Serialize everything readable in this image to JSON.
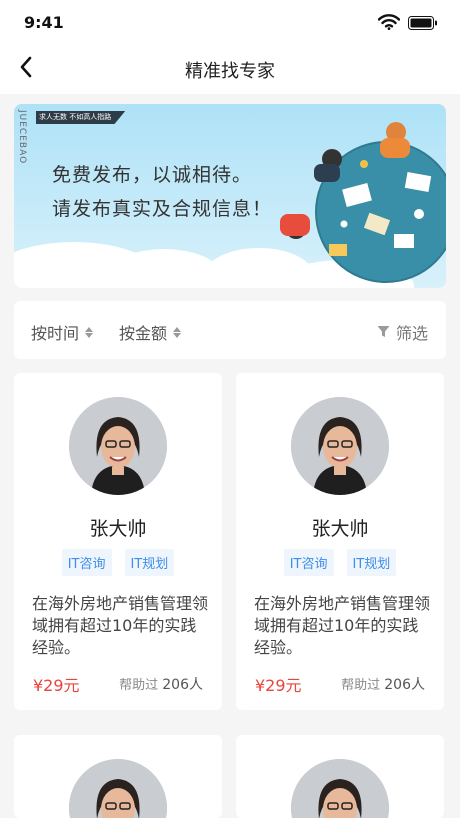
{
  "status_bar": {
    "time": "9:41",
    "icons": [
      "wifi-icon",
      "battery-icon"
    ]
  },
  "nav": {
    "title": "精准找专家",
    "back_icon": "chevron-left-icon"
  },
  "banner": {
    "brand": "JUECEBAO",
    "tag": "求人无数 不如高人指路",
    "line1": "免费发布，以诚相待。",
    "line2": "请发布真实及合规信息！"
  },
  "filters": {
    "sort_time": "按时间",
    "sort_amount": "按金额",
    "filter": "筛选",
    "filter_icon": "funnel-icon",
    "sort_icon": "sort-arrows-icon"
  },
  "experts": [
    {
      "name": "张大帅",
      "tags": [
        "IT咨询",
        "IT规划"
      ],
      "description": "在海外房地产销售管理领域拥有超过10年的实践经验。",
      "price": "¥29元",
      "helped_label": "帮助过",
      "helped_count": "206人"
    },
    {
      "name": "张大帅",
      "tags": [
        "IT咨询",
        "IT规划"
      ],
      "description": "在海外房地产销售管理领域拥有超过10年的实践经验。",
      "price": "¥29元",
      "helped_label": "帮助过",
      "helped_count": "206人"
    }
  ],
  "colors": {
    "accent": "#3f8ee8",
    "price": "#e8453c",
    "banner_bg": "#bfe7f8",
    "page_bg": "#f5f5f5"
  }
}
